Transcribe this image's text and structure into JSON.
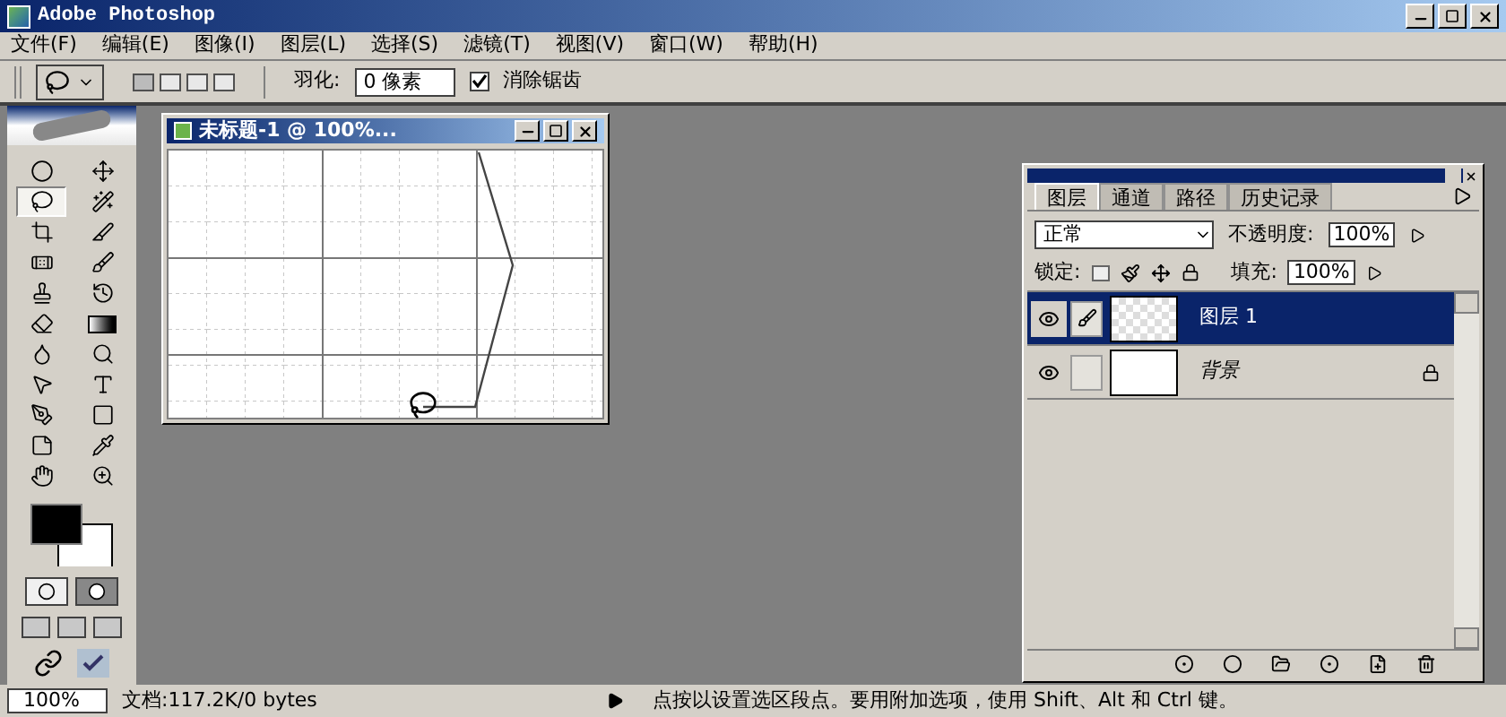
{
  "window": {
    "title": "Adobe Photoshop"
  },
  "menu": [
    "文件(F)",
    "编辑(E)",
    "图像(I)",
    "图层(L)",
    "选择(S)",
    "滤镜(T)",
    "视图(V)",
    "窗口(W)",
    "帮助(H)"
  ],
  "options": {
    "feather_label": "羽化:",
    "feather_value": "0 像素",
    "anti_alias": {
      "label": "消除锯齿",
      "checked": true
    }
  },
  "tools": [
    {
      "kind": "marquee",
      "selected": false
    },
    {
      "kind": "move",
      "selected": false
    },
    {
      "kind": "lasso",
      "selected": true
    },
    {
      "kind": "wand",
      "selected": false
    },
    {
      "kind": "crop",
      "selected": false
    },
    {
      "kind": "slice",
      "selected": false
    },
    {
      "kind": "healing",
      "selected": false
    },
    {
      "kind": "brush",
      "selected": false
    },
    {
      "kind": "stamp",
      "selected": false
    },
    {
      "kind": "history",
      "selected": false
    },
    {
      "kind": "eraser",
      "selected": false
    },
    {
      "kind": "gradient",
      "selected": false
    },
    {
      "kind": "blur",
      "selected": false
    },
    {
      "kind": "dodge",
      "selected": false
    },
    {
      "kind": "select",
      "selected": false
    },
    {
      "kind": "type",
      "selected": false
    },
    {
      "kind": "pen",
      "selected": false
    },
    {
      "kind": "shape",
      "selected": false
    },
    {
      "kind": "notes",
      "selected": false
    },
    {
      "kind": "eyedropper",
      "selected": false
    },
    {
      "kind": "hand",
      "selected": false
    },
    {
      "kind": "zoom",
      "selected": false
    }
  ],
  "document": {
    "title": "未标题-1 @ 100%..."
  },
  "layers_panel": {
    "tabs": [
      {
        "label": "图层",
        "selected": true
      },
      {
        "label": "通道",
        "selected": false
      },
      {
        "label": "路径",
        "selected": false
      },
      {
        "label": "历史记录",
        "selected": false
      }
    ],
    "blend_mode": "正常",
    "opacity_label": "不透明度:",
    "opacity_value": "100%",
    "lock_label": "锁定:",
    "fill_label": "填充:",
    "fill_value": "100%",
    "layers": [
      {
        "name": "图层 1",
        "selected": true,
        "locked": false,
        "transparent": true
      },
      {
        "name": "背景",
        "selected": false,
        "locked": true,
        "transparent": false
      }
    ]
  },
  "status_bar": {
    "zoom": "100%",
    "doc_size": "文档:117.2K/0 bytes",
    "hint": "点按以设置选区段点。要用附加选项，使用 Shift、Alt 和 Ctrl 键。"
  }
}
